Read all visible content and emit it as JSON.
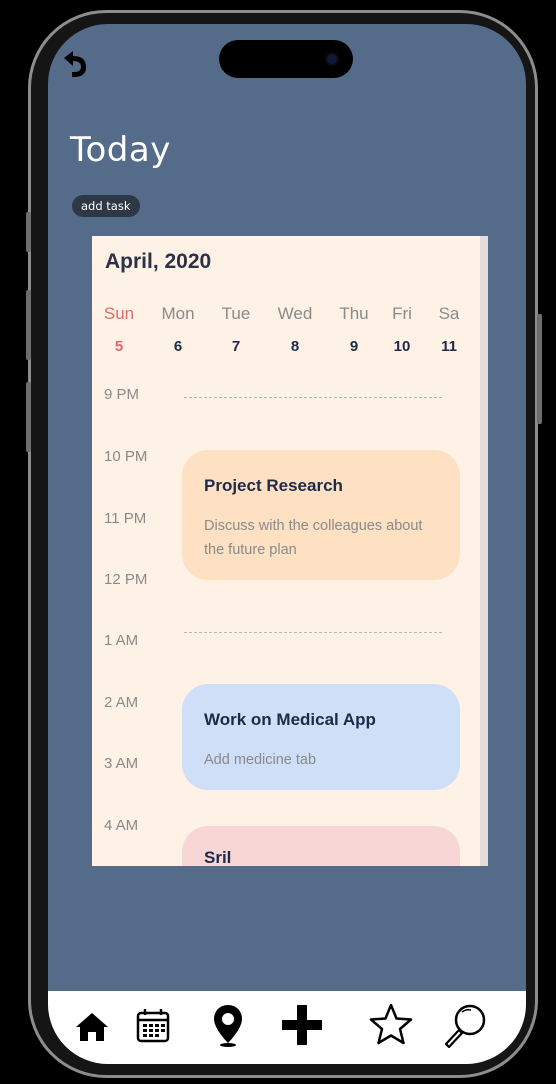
{
  "header": {
    "title": "Today",
    "add_task_label": "add task"
  },
  "calendar": {
    "month": "April, 2020",
    "days": [
      {
        "name": "Sun",
        "date": "5",
        "active": true
      },
      {
        "name": "Mon",
        "date": "6"
      },
      {
        "name": "Tue",
        "date": "7"
      },
      {
        "name": "Wed",
        "date": "8"
      },
      {
        "name": "Thu",
        "date": "9"
      },
      {
        "name": "Fri",
        "date": "10"
      },
      {
        "name": "Sa",
        "date": "11"
      }
    ],
    "hours": [
      "9 PM",
      "10 PM",
      "11 PM",
      "12 PM",
      "1 AM",
      "2 AM",
      "3 AM",
      "4 AM"
    ],
    "events": [
      {
        "title": "Project Research",
        "description": "Discuss with the colleagues about the future plan"
      },
      {
        "title": "Work on Medical App",
        "description": "Add medicine tab"
      },
      {
        "title": "Sril",
        "description": ""
      }
    ]
  },
  "colors": {
    "screen_bg": "#556b8a",
    "calendar_bg": "#fdf2e5",
    "active_day": "#e06a6a",
    "event_orange": "#fde1c2",
    "event_blue": "#cfdff7",
    "event_pink": "#f8d6d6"
  },
  "nav": {
    "icons": [
      "home-icon",
      "calendar-icon",
      "location-pin-icon",
      "plus-icon",
      "star-icon",
      "search-icon"
    ]
  }
}
